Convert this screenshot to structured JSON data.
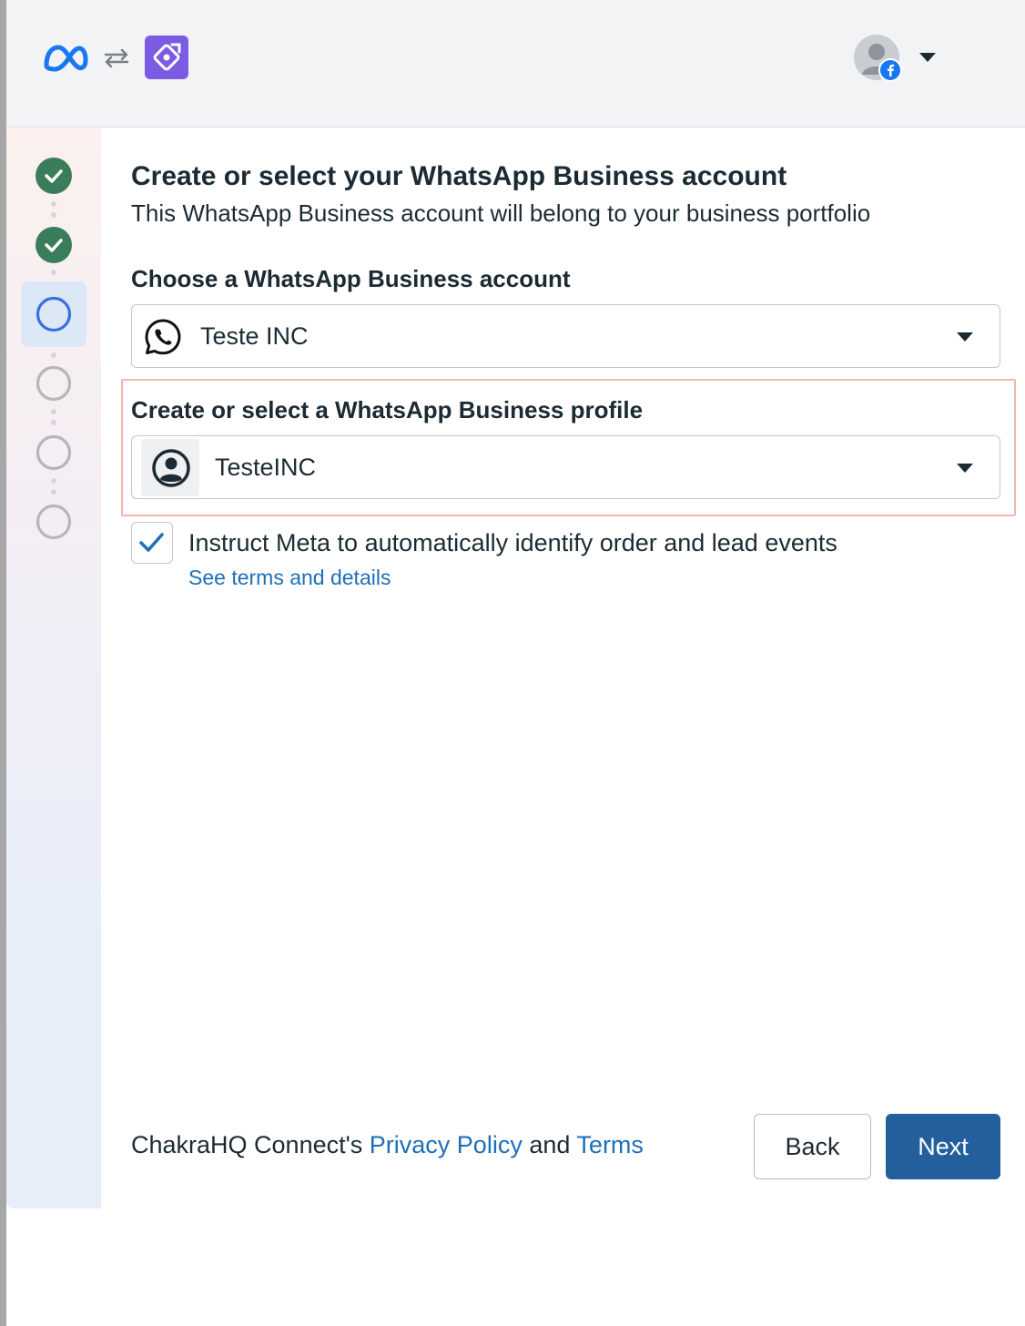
{
  "header": {
    "meta_logo_icon": "meta-infinity-logo",
    "swap_icon": "arrows-swap-icon",
    "app_icon": "chakra-app-icon",
    "account_avatar_icon": "user-avatar-with-facebook-badge",
    "account_menu_icon": "caret-down-icon"
  },
  "stepper": {
    "steps": [
      {
        "state": "complete"
      },
      {
        "state": "complete"
      },
      {
        "state": "current"
      },
      {
        "state": "pending"
      },
      {
        "state": "pending"
      },
      {
        "state": "pending"
      }
    ]
  },
  "page": {
    "title": "Create or select your WhatsApp Business account",
    "subtitle": "This WhatsApp Business account will belong to your business portfolio"
  },
  "account_field": {
    "label": "Choose a WhatsApp Business account",
    "value": "Teste INC",
    "icon": "whatsapp-icon"
  },
  "profile_field": {
    "label": "Create or select a WhatsApp Business profile",
    "value": "TesteINC",
    "icon": "profile-avatar-icon"
  },
  "auto_events": {
    "checked": true,
    "label": "Instruct Meta to automatically identify order and lead events",
    "link": "See terms and details"
  },
  "footer": {
    "prefix": "ChakraHQ Connect's",
    "privacy_link": "Privacy Policy",
    "and": "and",
    "terms_link": "Terms",
    "back_label": "Back",
    "next_label": "Next"
  },
  "colors": {
    "primary": "#245f9d",
    "link": "#1d6fb8",
    "success": "#3a7d5b",
    "active_step": "#3a6fe0",
    "highlight_border": "#efb7ad",
    "app_icon_bg": "#7b5be3"
  }
}
